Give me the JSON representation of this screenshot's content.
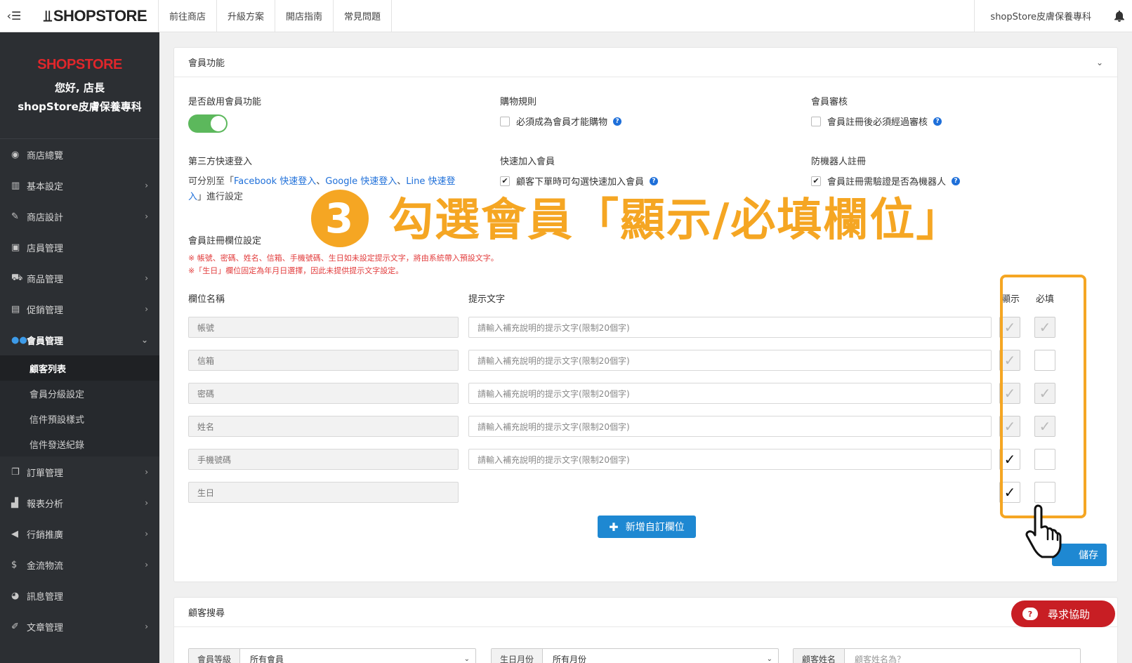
{
  "topbar": {
    "logo": "SHOPSTORE",
    "nav": [
      "前往商店",
      "升級方案",
      "開店指南",
      "常見問題"
    ],
    "store_name": "shopStore皮膚保養專科"
  },
  "sidebar": {
    "brand_logo": "SHOPSTORE",
    "greeting": "您好, 店長",
    "store": "shopStore皮膚保養專科",
    "items": [
      {
        "label": "商店總覽",
        "icon": "dashboard-icon"
      },
      {
        "label": "基本設定",
        "icon": "bank-icon"
      },
      {
        "label": "商店設計",
        "icon": "brush-icon"
      },
      {
        "label": "店員管理",
        "icon": "lock-icon"
      },
      {
        "label": "商品管理",
        "icon": "cart-icon"
      },
      {
        "label": "促銷管理",
        "icon": "gift-icon"
      },
      {
        "label": "會員管理",
        "icon": "users-icon"
      },
      {
        "label": "訂單管理",
        "icon": "copy-icon"
      },
      {
        "label": "報表分析",
        "icon": "bar-chart-icon"
      },
      {
        "label": "行銷推廣",
        "icon": "megaphone-icon"
      },
      {
        "label": "金流物流",
        "icon": "dollar-icon"
      },
      {
        "label": "訊息管理",
        "icon": "chat-icon"
      },
      {
        "label": "文章管理",
        "icon": "edit-icon"
      }
    ],
    "subitems": [
      "顧客列表",
      "會員分級設定",
      "信件預設樣式",
      "信件發送紀錄"
    ]
  },
  "member": {
    "title": "會員功能",
    "enable_label": "是否啟用會員功能",
    "shopping_rule_label": "購物規則",
    "shopping_rule_check": "必須成為會員才能購物",
    "review_label": "會員審核",
    "review_check": "會員註冊後必須經過審核",
    "third_party_label": "第三方快速登入",
    "third_party_pre": "可分別至「",
    "fb_link": "Facebook 快速登入",
    "sep1": "、",
    "google_link": "Google 快速登入",
    "sep2": "、",
    "line_link1": "Line 快速登",
    "line_link2": "入",
    "third_party_post": "」進行設定",
    "quick_join_label": "快速加入會員",
    "quick_join_check": "顧客下單時可勾選快速加入會員",
    "anti_bot_label": "防機器人註冊",
    "anti_bot_check": "會員註冊需驗證是否為機器人",
    "reg_fields_label": "會員註冊欄位設定",
    "note1": "※ 帳號、密碼、姓名、信箱、手機號碼、生日如未設定提示文字，將由系統帶入預設文字。",
    "note2": "※「生日」欄位固定為年月日選擇，因此未提供提示文字設定。",
    "col_name": "欄位名稱",
    "col_hint": "提示文字",
    "col_show": "顯示",
    "col_required": "必填",
    "hint_placeholder": "請輸入補充說明的提示文字(限制20個字)",
    "fields": [
      {
        "name": "帳號",
        "show": "disabled-checked",
        "required": "disabled-checked"
      },
      {
        "name": "信箱",
        "show": "disabled-checked",
        "required": "unchecked"
      },
      {
        "name": "密碼",
        "show": "disabled-checked",
        "required": "disabled-checked"
      },
      {
        "name": "姓名",
        "show": "disabled-checked",
        "required": "disabled-checked"
      },
      {
        "name": "手機號碼",
        "show": "checked",
        "required": "unchecked"
      },
      {
        "name": "生日",
        "show": "checked",
        "required": "unchecked"
      }
    ],
    "add_field": "新增自訂欄位",
    "save": "儲存"
  },
  "annotation": {
    "number": "3",
    "text": "勾選會員「顯示/必填欄位」"
  },
  "search": {
    "title": "顧客搜尋",
    "level_label": "會員等級",
    "level_value": "所有會員",
    "birth_label": "生日月份",
    "birth_value": "所有月份",
    "name_label": "顧客姓名",
    "name_placeholder": "顧客姓名為？"
  },
  "help": {
    "label": "尋求協助"
  },
  "colors": {
    "accent": "#1e88d2",
    "highlight": "#f5a623",
    "help": "#c81e24",
    "sidebar": "#2c2f33",
    "toggle": "#5cb85c"
  }
}
